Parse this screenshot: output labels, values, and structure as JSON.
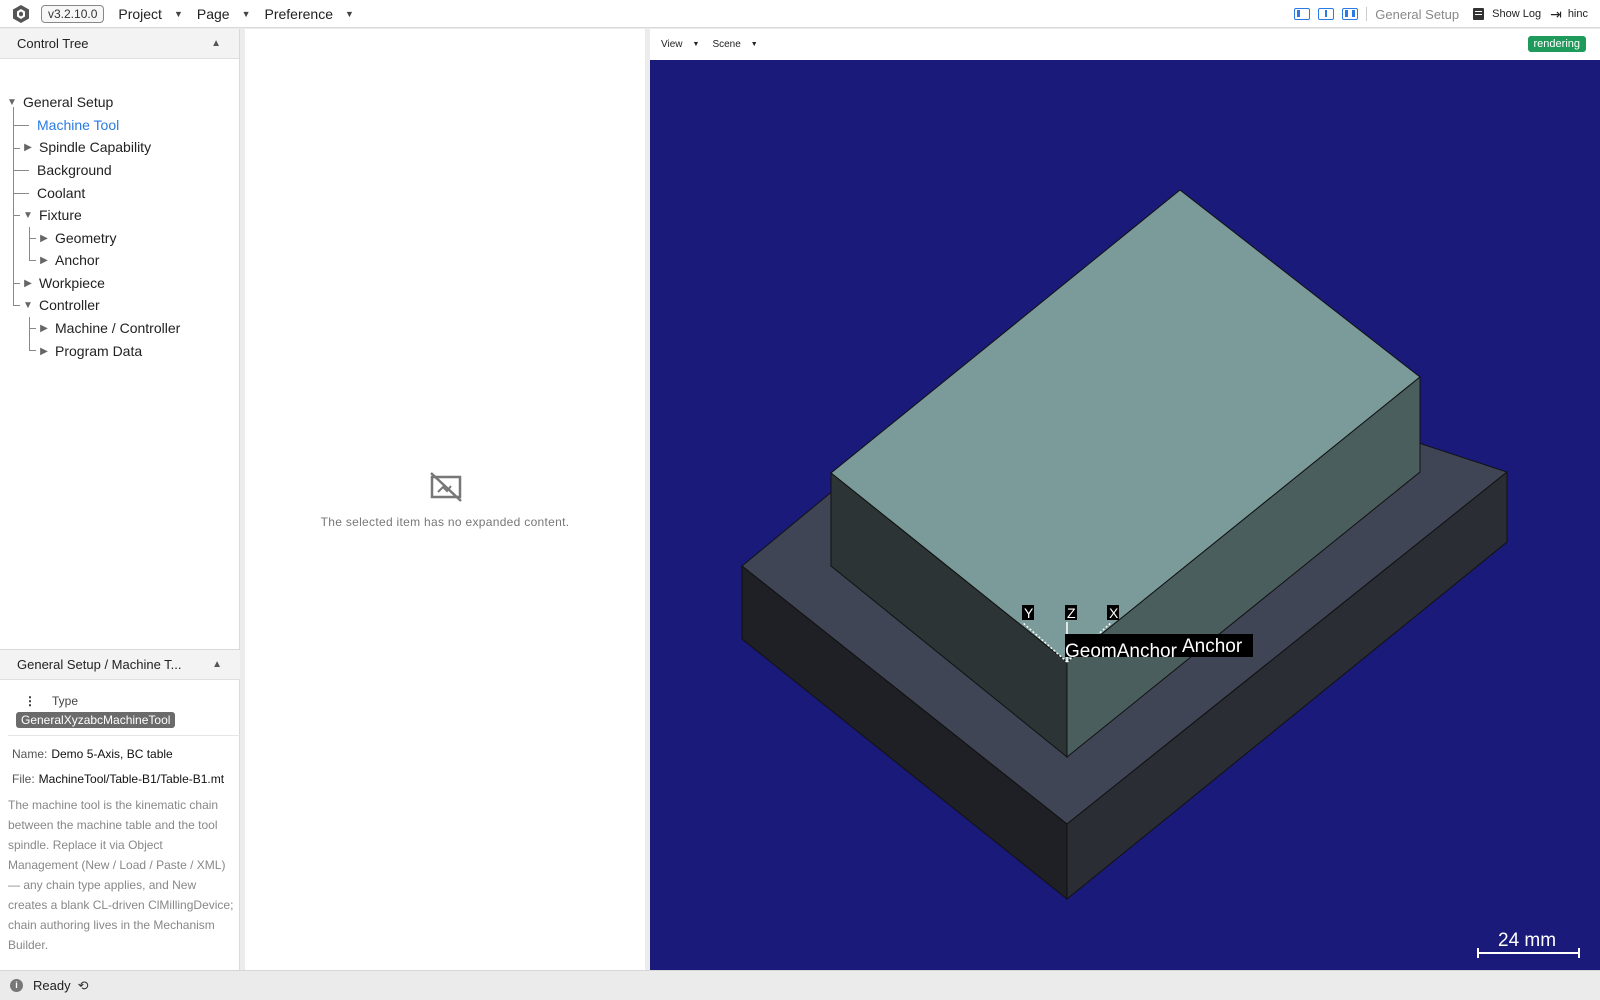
{
  "app": {
    "version": "v3.2.10.0",
    "menus": [
      "Project",
      "Page",
      "Preference"
    ],
    "current_page": "General Setup",
    "show_log": "Show Log",
    "user": "hinc"
  },
  "tree": {
    "title": "Control Tree",
    "nodes": {
      "general_setup": "General Setup",
      "machine_tool": "Machine Tool",
      "spindle_capability": "Spindle Capability",
      "background": "Background",
      "coolant": "Coolant",
      "fixture": "Fixture",
      "geometry": "Geometry",
      "anchor": "Anchor",
      "workpiece": "Workpiece",
      "controller": "Controller",
      "machine_controller": "Machine / Controller",
      "program_data": "Program Data"
    }
  },
  "details": {
    "title": "General Setup / Machine T...",
    "type_label": "Type",
    "type_value": "GeneralXyzabcMachineTool",
    "name_label": "Name:",
    "name_value": "Demo 5-Axis, BC table",
    "file_label": "File:",
    "file_value": "MachineTool/Table-B1/Table-B1.mt",
    "description": "The machine tool is the kinematic chain between the machine table and the tool spindle. Replace it via Object Management (New / Load / Paste / XML) — any chain type applies, and New creates a blank CL-driven ClMillingDevice; chain authoring lives in the Mechanism Builder."
  },
  "middle": {
    "empty_message": "The selected item has no expanded content."
  },
  "viewport": {
    "view_menu": "View",
    "scene_menu": "Scene",
    "status": "rendering",
    "axis_labels": {
      "x": "X",
      "y": "Y",
      "z": "Z"
    },
    "anchor_label_1": "GeomAnchor",
    "anchor_label_2": "Anchor",
    "scale_label": "24 mm",
    "colors": {
      "background": "#1a1a7a",
      "top_block": "#7b9a9a",
      "base": "#3e4350"
    }
  },
  "status_bar": {
    "text": "Ready"
  }
}
